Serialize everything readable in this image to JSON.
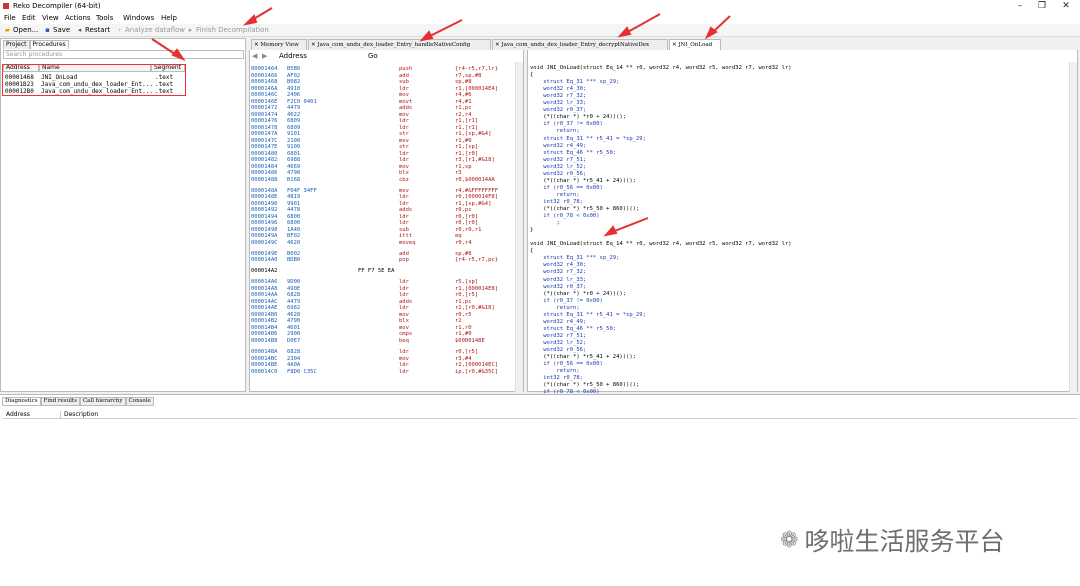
{
  "title": "Reko Decompiler (64-bit)",
  "menu": [
    "File",
    "Edit",
    "View",
    "Actions",
    "Tools",
    "Windows",
    "Help"
  ],
  "toolbar": {
    "open": "Open...",
    "save": "Save",
    "restart": "Restart",
    "analyze": "Analyze dataflow",
    "finish": "Finish Decompilation"
  },
  "left": {
    "tabs": [
      "Project",
      "Procedures"
    ],
    "search_placeholder": "Search procedures",
    "headers": [
      "Address",
      "Name",
      "Segment"
    ],
    "rows": [
      {
        "addr": "00001468",
        "name": "JNI_OnLoad",
        "seg": ".text"
      },
      {
        "addr": "00001B23",
        "name": "Java_com_undu_dex_loader_Ent...",
        "seg": ".text"
      },
      {
        "addr": "000012B0",
        "name": "Java_com_undu_dex_loader_Ent...",
        "seg": ".text"
      }
    ]
  },
  "tabs": [
    "Memory View",
    "Java_com_undu_dex_loader_Entry_handleNativeConfig",
    "Java_com_undu_dex_loader_Entry_decryptNativeDex",
    "JNI_OnLoad"
  ],
  "addressbar": {
    "label": "Address",
    "go": "Go"
  },
  "disasm": [
    [
      "00001464",
      "B5B0",
      "push",
      "{r4-r5,r7,lr}"
    ],
    [
      "00001466",
      "AF02",
      "add",
      "r7,sp,#8"
    ],
    [
      "00001468",
      "B082",
      "sub",
      "sp,#8"
    ],
    [
      "0000146A",
      "4910",
      "ldr",
      "r1,[000014E4]"
    ],
    [
      "0000146C",
      "2406",
      "mov",
      "r4,#6"
    ],
    [
      "0000146E",
      "F2C0 0401",
      "movt",
      "r4,#1"
    ],
    [
      "00001472",
      "4479",
      "adds",
      "r1,pc"
    ],
    [
      "00001474",
      "4622",
      "mov",
      "r2,r4"
    ],
    [
      "00001476",
      "6809",
      "ldr",
      "r1,[r1]"
    ],
    [
      "00001478",
      "6809",
      "ldr",
      "r1,[r1]"
    ],
    [
      "0000147A",
      "9101",
      "str",
      "r1,[sp,#&4]"
    ],
    [
      "0000147C",
      "2100",
      "mov",
      "r1,#0"
    ],
    [
      "0000147E",
      "9100",
      "str",
      "r1,[sp]"
    ],
    [
      "00001480",
      "6801",
      "ldr",
      "r1,[r0]"
    ],
    [
      "00001482",
      "6988",
      "ldr",
      "r3,[r1,#&18]"
    ],
    [
      "00001484",
      "4669",
      "mov",
      "r1,sp"
    ],
    [
      "00001486",
      "4798",
      "blx",
      "r3"
    ],
    [
      "00001488",
      "B168",
      "cbz",
      "r0,$000014AA"
    ],
    [
      "",
      "",
      "",
      ""
    ],
    [
      "0000148A",
      "F04F 34FF",
      "mov",
      "r4,#&FFFFFFFF"
    ],
    [
      "0000148E",
      "4819",
      "ldr",
      "r0,[000014F8]"
    ],
    [
      "00001490",
      "9901",
      "ldr",
      "r1,[sp,#&4]"
    ],
    [
      "00001492",
      "4478",
      "adds",
      "r0,pc"
    ],
    [
      "00001494",
      "6800",
      "ldr",
      "r0,[r0]"
    ],
    [
      "00001496",
      "6800",
      "ldr",
      "r0,[r0]"
    ],
    [
      "00001498",
      "1A40",
      "sub",
      "r0,r0,r1"
    ],
    [
      "0000149A",
      "BF02",
      "ittt",
      "eq"
    ],
    [
      "0000149C",
      "4620",
      "moveq",
      "r0,r4"
    ],
    [
      "",
      "",
      "",
      ""
    ],
    [
      "0000149E",
      "B002",
      "add",
      "sp,#8"
    ],
    [
      "000014A0",
      "BDB0",
      "pop",
      "{r4-r5,r7,pc}"
    ],
    [
      "",
      "",
      "",
      ""
    ],
    [
      "000014A2",
      "FF F7 5E EA",
      "",
      ""
    ],
    [
      "",
      "",
      "",
      ""
    ],
    [
      "000014A6",
      "9D00",
      "ldr",
      "r5,[sp]"
    ],
    [
      "000014A8",
      "490E",
      "ldr",
      "r1,[000014E8]"
    ],
    [
      "000014AA",
      "6828",
      "ldr",
      "r0,[r5]"
    ],
    [
      "000014AC",
      "4479",
      "adds",
      "r1,pc"
    ],
    [
      "000014AE",
      "6982",
      "ldr",
      "r2,[r0,#&18]"
    ],
    [
      "000014B0",
      "4628",
      "mov",
      "r0,r5"
    ],
    [
      "000014B2",
      "4790",
      "blx",
      "r2"
    ],
    [
      "000014B4",
      "4601",
      "mov",
      "r1,r0"
    ],
    [
      "000014B6",
      "2900",
      "cmps",
      "r1,#0"
    ],
    [
      "000014B8",
      "D0E7",
      "beq",
      "$0000148E"
    ],
    [
      "",
      "",
      "",
      ""
    ],
    [
      "000014BA",
      "6828",
      "ldr",
      "r0,[r5]"
    ],
    [
      "000014BC",
      "2304",
      "mov",
      "r3,#4"
    ],
    [
      "000014BE",
      "4A0A",
      "ldr",
      "r2,[000014EC]"
    ],
    [
      "000014C0",
      "F8D0 C35C",
      "ldr",
      "ip,[r0,#&35C]"
    ]
  ],
  "code": [
    "void JNI_OnLoad(struct Eq_14 ** r0, word32 r4, word32 r5, word32 r7, word32 lr)",
    "{",
    "    struct Eq_31 *** sp_29;",
    "    word32 r4_30;",
    "    word32 r7_32;",
    "    word32 lr_33;",
    "    word32 r0_37;",
    "    (*((char *) *r0 + 24))();",
    "    if (r0_37 != 0x00)",
    "        return;",
    "    struct Eq_31 ** r5_41 = *sp_29;",
    "    word32 r4_49;",
    "    struct Eq_46 ** r5_50;",
    "    word32 r7_51;",
    "    word32 lr_52;",
    "    word32 r0_56;",
    "    (*((char *) *r5_41 + 24))();",
    "    if (r0_56 == 0x00)",
    "        return;",
    "    int32 r0_78;",
    "    (*((char *) *r5_50 + 860))();",
    "    if (r0_78 < 0x00)",
    "        ;",
    "}",
    "",
    "void JNI_OnLoad(struct Eq_14 ** r0, word32 r4, word32 r5, word32 r7, word32 lr)",
    "{",
    "    struct Eq_31 *** sp_29;",
    "    word32 r4_30;",
    "    word32 r7_32;",
    "    word32 lr_33;",
    "    word32 r0_37;",
    "    (*((char *) *r0 + 24))();",
    "    if (r0_37 != 0x00)",
    "        return;",
    "    struct Eq_31 ** r5_41 = *sp_29;",
    "    word32 r4_49;",
    "    struct Eq_46 ** r5_50;",
    "    word32 r7_51;",
    "    word32 lr_52;",
    "    word32 r0_56;",
    "    (*((char *) *r5_41 + 24))();",
    "    if (r0_56 == 0x00)",
    "        return;",
    "    int32 r0_78;",
    "    (*((char *) *r5_50 + 860))();",
    "    if (r0_78 < 0x00)"
  ],
  "bottom": {
    "tabs": [
      "Diagnostics",
      "Find results",
      "Call hierarchy",
      "Console"
    ],
    "headers": [
      "Address",
      "Description"
    ]
  },
  "watermark": "哆啦生活服务平台",
  "colors": {
    "accent_red": "#e33030",
    "addr_blue": "#1a5fb4",
    "mnemonic_red": "#b01515"
  }
}
